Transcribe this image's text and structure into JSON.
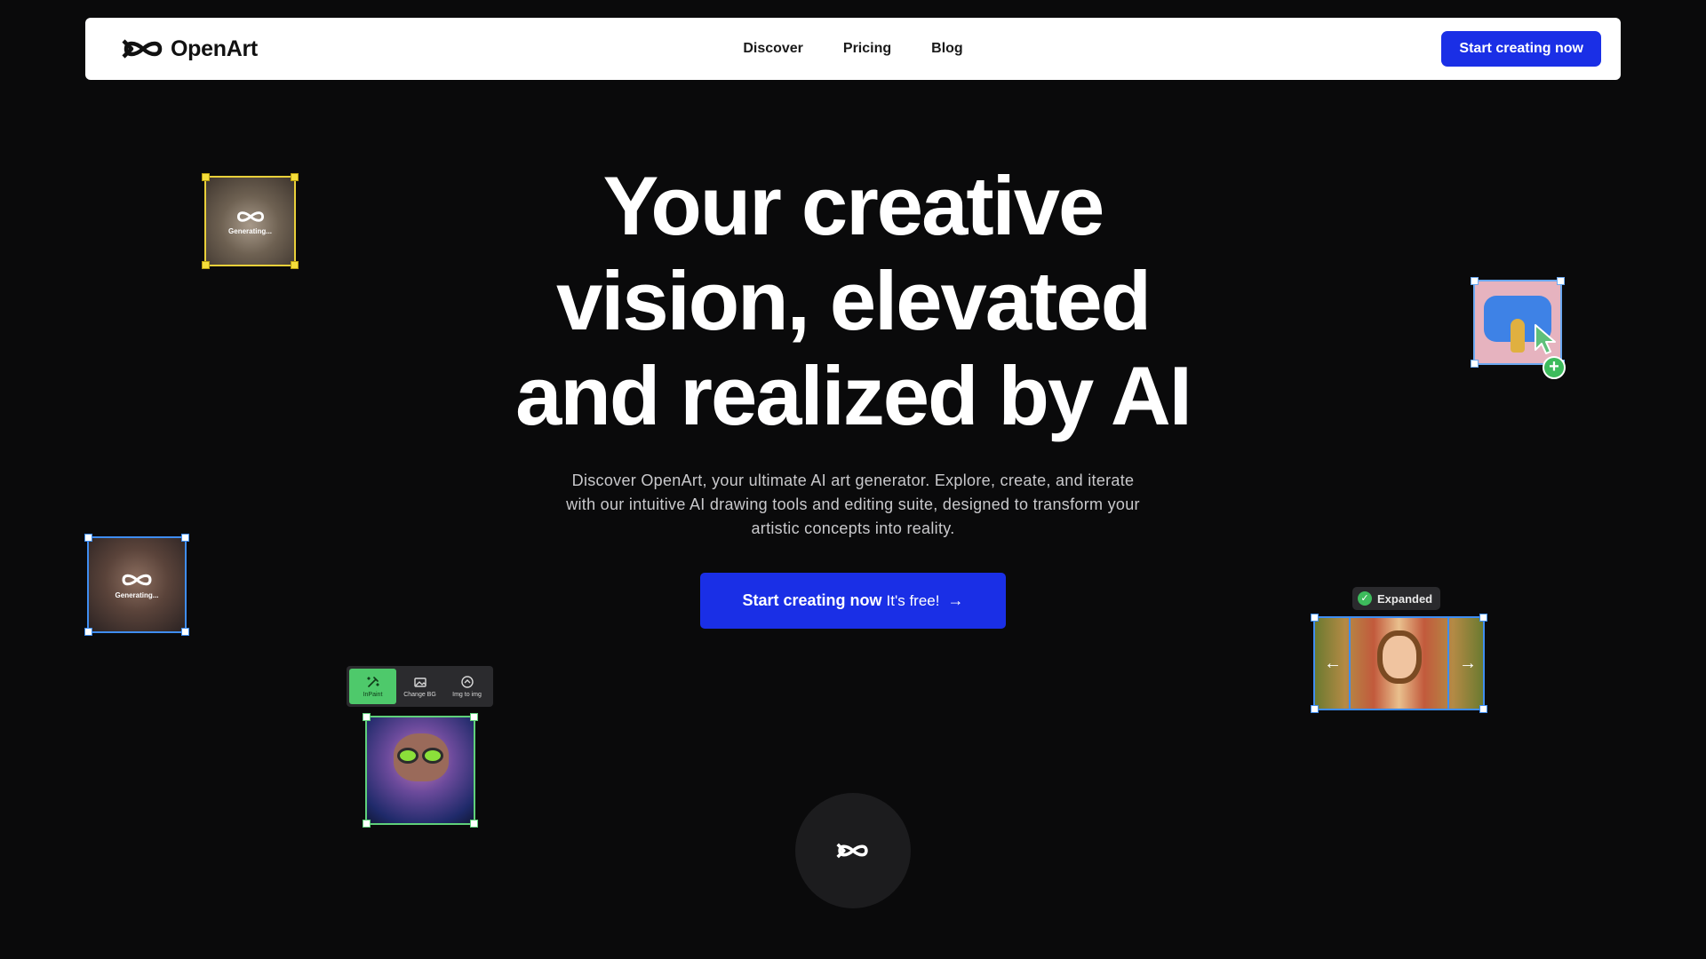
{
  "nav": {
    "brand": "OpenArt",
    "links": [
      "Discover",
      "Pricing",
      "Blog"
    ],
    "cta": "Start creating now"
  },
  "hero": {
    "title_lines": [
      "Your creative",
      "vision, elevated",
      "and realized by AI"
    ],
    "subtitle": "Discover OpenArt, your ultimate AI art generator. Explore, create, and iterate with our intuitive AI drawing tools and editing suite, designed to transform your artistic concepts into reality.",
    "cta_main": "Start creating now",
    "cta_sub": "It's free!",
    "cta_arrow": "→"
  },
  "cards": {
    "generating_label": "Generating...",
    "toolbar": [
      {
        "label": "InPaint",
        "icon": "inpaint-icon",
        "active": true
      },
      {
        "label": "Change BG",
        "icon": "change-bg-icon",
        "active": false
      },
      {
        "label": "Img to img",
        "icon": "img-to-img-icon",
        "active": false
      }
    ],
    "expanded_label": "Expanded",
    "plus": "+",
    "check": "✓",
    "arrow_left": "←",
    "arrow_right": "→"
  },
  "colors": {
    "background": "#0a0a0b",
    "accent": "#1a2fe6",
    "yellow_frame": "#e9d03a",
    "blue_frame": "#3f8df0",
    "green_frame": "#5fd07a"
  }
}
